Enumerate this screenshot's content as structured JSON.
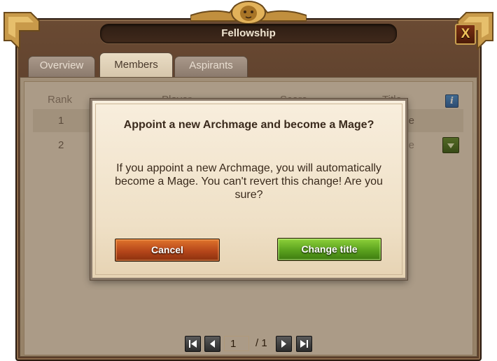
{
  "window": {
    "title": "Fellowship",
    "close_label": "X"
  },
  "tabs": [
    {
      "label": "Overview",
      "active": false
    },
    {
      "label": "Members",
      "active": true
    },
    {
      "label": "Aspirants",
      "active": false
    }
  ],
  "table": {
    "headers": {
      "rank": "Rank",
      "player": "Player",
      "score": "Score",
      "title": "Title"
    },
    "info_label": "i",
    "rows": [
      {
        "rank": "1",
        "title_visible": "age"
      },
      {
        "rank": "2",
        "title_visible": "age"
      }
    ]
  },
  "pagination": {
    "current_page": "1",
    "total": "/ 1"
  },
  "dialog": {
    "title": "Appoint a new Archmage and become a Mage?",
    "message": "If you appoint a new Archmage, you will automatically become a Mage. You can't revert this change! Are you sure?",
    "cancel_label": "Cancel",
    "confirm_label": "Change title"
  },
  "colors": {
    "frame": "#4e3424",
    "cancel_button": "#b5461a",
    "confirm_button": "#5aa11e",
    "dialog_bg": "#f3e6cf"
  }
}
